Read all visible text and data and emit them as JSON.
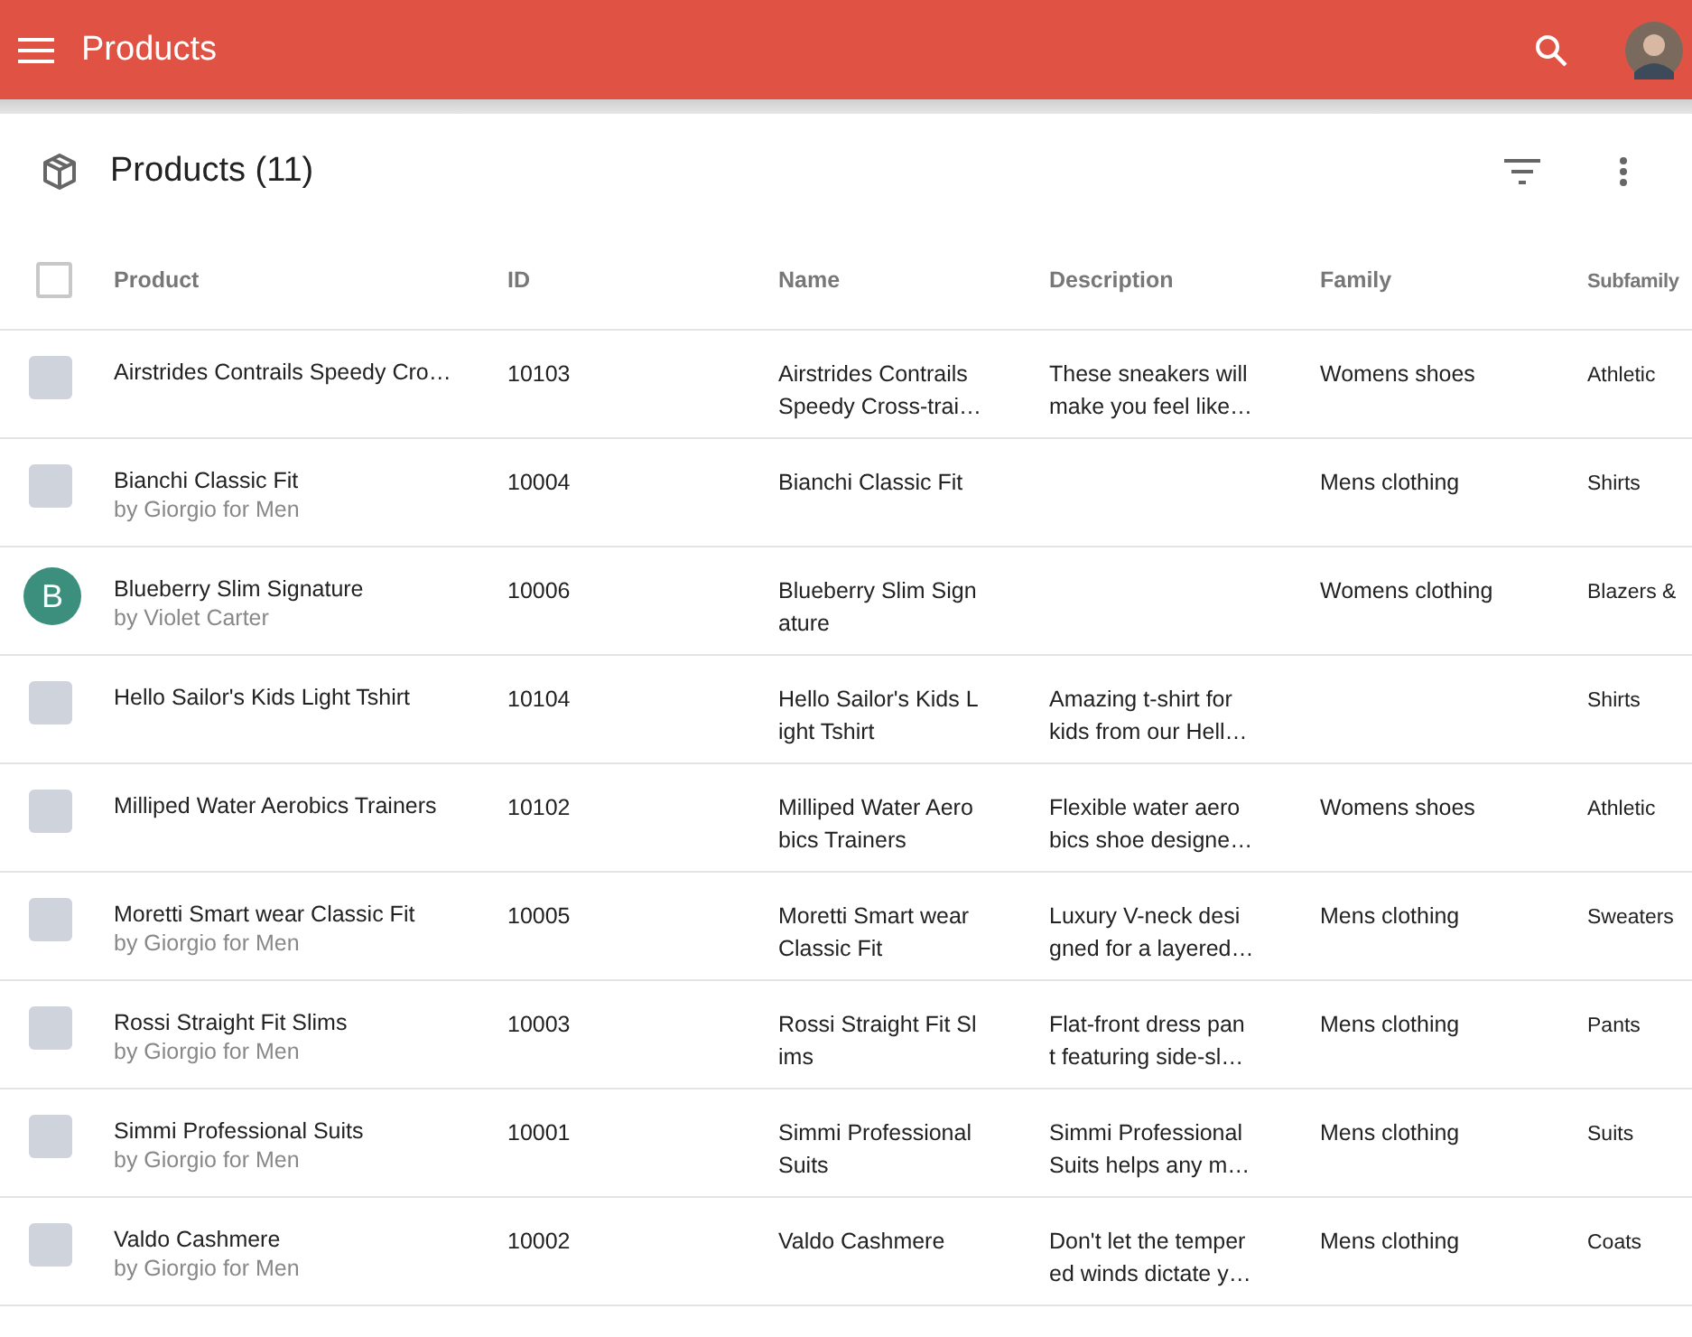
{
  "app_bar": {
    "title": "Products"
  },
  "panel": {
    "title": "Products (11)"
  },
  "table": {
    "select_all": {
      "checked": false
    },
    "columns": [
      "Product",
      "ID",
      "Name",
      "Description",
      "Family",
      "Subfamily"
    ],
    "rows": [
      {
        "thumb": {
          "kind": "photo"
        },
        "product": "Airstrides Contrails Speedy Cro…",
        "maker": null,
        "id": "10103",
        "name": [
          "Airstrides Contrails",
          "Speedy Cross-trai…"
        ],
        "description": [
          "These sneakers will",
          "make you feel like…"
        ],
        "family": "Womens shoes",
        "subfamily": "Athletic"
      },
      {
        "thumb": {
          "kind": "photo"
        },
        "product": "Bianchi Classic Fit",
        "maker": "by Giorgio for Men",
        "id": "10004",
        "name": [
          "Bianchi Classic Fit"
        ],
        "description": [],
        "family": "Mens clothing",
        "subfamily": "Shirts"
      },
      {
        "thumb": {
          "kind": "letter",
          "letter": "B",
          "color": "#3b8f7c"
        },
        "product": "Blueberry Slim Signature",
        "maker": "by Violet Carter",
        "id": "10006",
        "name": [
          "Blueberry Slim Sign",
          "ature"
        ],
        "description": [],
        "family": "Womens clothing",
        "subfamily": "Blazers &"
      },
      {
        "thumb": {
          "kind": "photo"
        },
        "product": "Hello Sailor's Kids Light Tshirt",
        "maker": null,
        "id": "10104",
        "name": [
          "Hello Sailor's Kids L",
          "ight Tshirt"
        ],
        "description": [
          "Amazing t-shirt for",
          "kids from our Hell…"
        ],
        "family": null,
        "subfamily": "Shirts"
      },
      {
        "thumb": {
          "kind": "photo"
        },
        "product": "Milliped Water Aerobics Trainers",
        "maker": null,
        "id": "10102",
        "name": [
          "Milliped Water Aero",
          "bics Trainers"
        ],
        "description": [
          "Flexible water aero",
          "bics shoe designe…"
        ],
        "family": "Womens shoes",
        "subfamily": "Athletic"
      },
      {
        "thumb": {
          "kind": "photo"
        },
        "product": "Moretti Smart wear Classic Fit",
        "maker": "by Giorgio for Men",
        "id": "10005",
        "name": [
          "Moretti Smart wear",
          "Classic Fit"
        ],
        "description": [
          "Luxury V-neck desi",
          "gned for a layered…"
        ],
        "family": "Mens clothing",
        "subfamily": "Sweaters"
      },
      {
        "thumb": {
          "kind": "photo"
        },
        "product": "Rossi Straight Fit Slims",
        "maker": "by Giorgio for Men",
        "id": "10003",
        "name": [
          "Rossi Straight Fit Sl",
          "ims"
        ],
        "description": [
          "Flat-front dress pan",
          "t featuring side-sl…"
        ],
        "family": "Mens clothing",
        "subfamily": "Pants"
      },
      {
        "thumb": {
          "kind": "photo"
        },
        "product": "Simmi Professional Suits",
        "maker": "by Giorgio for Men",
        "id": "10001",
        "name": [
          "Simmi Professional",
          "Suits"
        ],
        "description": [
          "Simmi Professional",
          "Suits helps any m…"
        ],
        "family": "Mens clothing",
        "subfamily": "Suits"
      },
      {
        "thumb": {
          "kind": "photo"
        },
        "product": "Valdo Cashmere",
        "maker": "by Giorgio for Men",
        "id": "10002",
        "name": [
          "Valdo Cashmere"
        ],
        "description": [
          "Don't let the temper",
          "ed winds dictate y…"
        ],
        "family": "Mens clothing",
        "subfamily": "Coats"
      }
    ]
  }
}
